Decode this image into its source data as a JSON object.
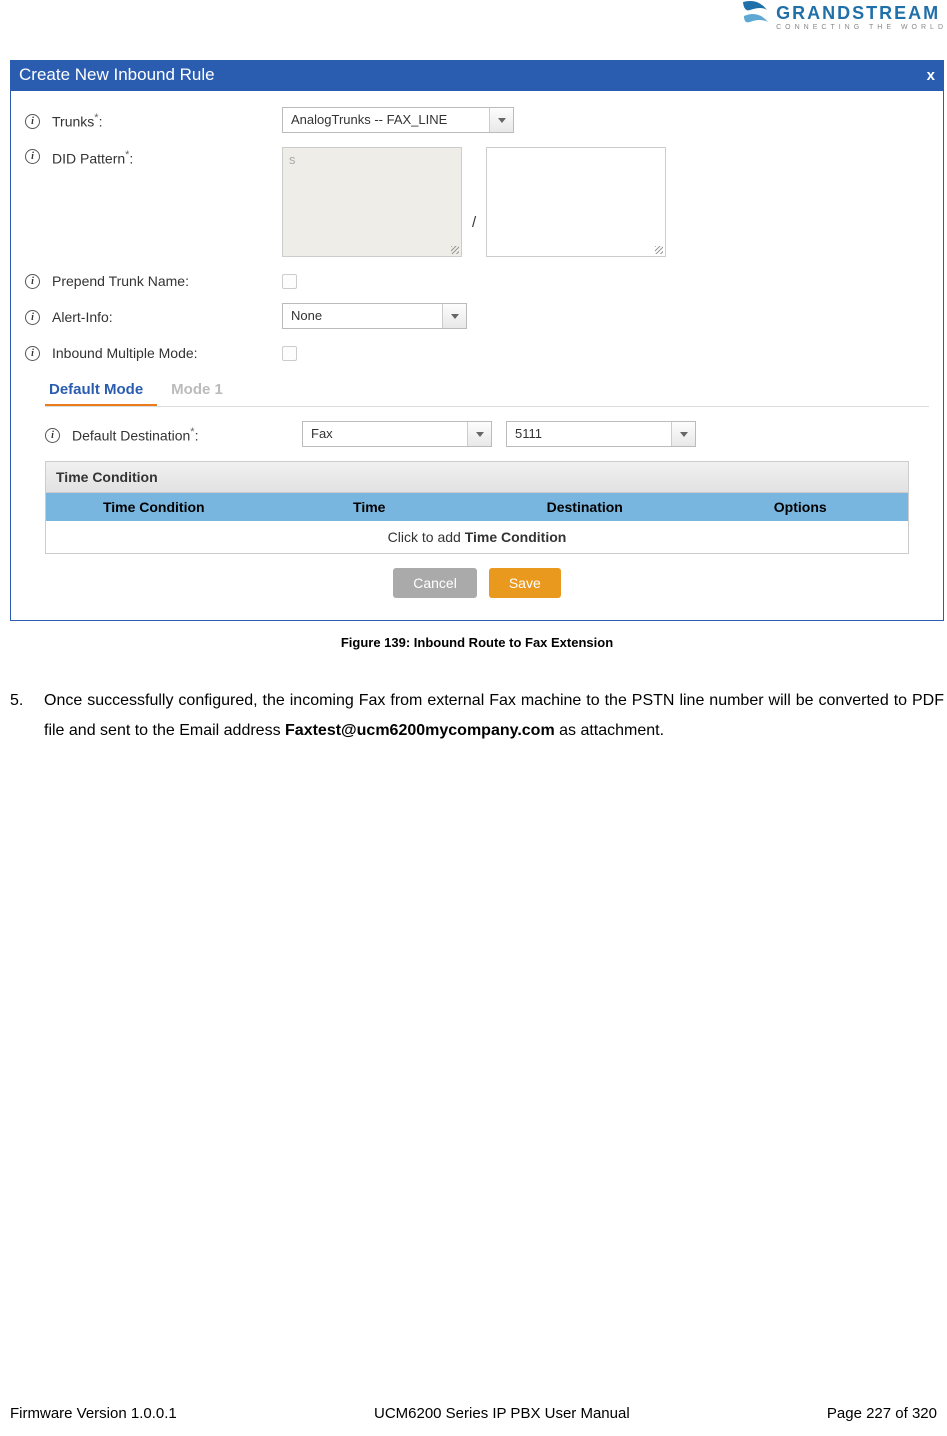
{
  "logo": {
    "name": "GRANDSTREAM",
    "tagline": "CONNECTING THE WORLD"
  },
  "dialog": {
    "title": "Create New Inbound Rule",
    "close": "x",
    "labels": {
      "trunks": "Trunks",
      "did": "DID Pattern",
      "prepend": "Prepend Trunk Name:",
      "alert": "Alert-Info:",
      "multi": "Inbound Multiple Mode:",
      "dest": "Default Destination"
    },
    "values": {
      "trunks": "AnalogTrunks -- FAX_LINE",
      "did_placeholder": "s",
      "alert": "None",
      "dest_type": "Fax",
      "dest_num": "5111"
    },
    "tabs": {
      "active": "Default Mode",
      "other": "Mode 1"
    },
    "time": {
      "header": "Time Condition",
      "cols": {
        "c1": "Time Condition",
        "c2": "Time",
        "c3": "Destination",
        "c4": "Options"
      },
      "add_pre": "Click to add ",
      "add_bold": "Time Condition"
    },
    "buttons": {
      "cancel": "Cancel",
      "save": "Save"
    }
  },
  "caption": "Figure 139: Inbound Route to Fax Extension",
  "para": {
    "num": "5.",
    "t1": "Once successfully configured, the incoming Fax from external Fax machine to the PSTN line number will be converted to PDF file and sent to the Email address ",
    "email": "Faxtest@ucm6200mycompany.com",
    "t2": " as attachment."
  },
  "footer": {
    "left": "Firmware Version 1.0.0.1",
    "center": "UCM6200 Series IP PBX User Manual",
    "right": "Page 227 of 320"
  }
}
